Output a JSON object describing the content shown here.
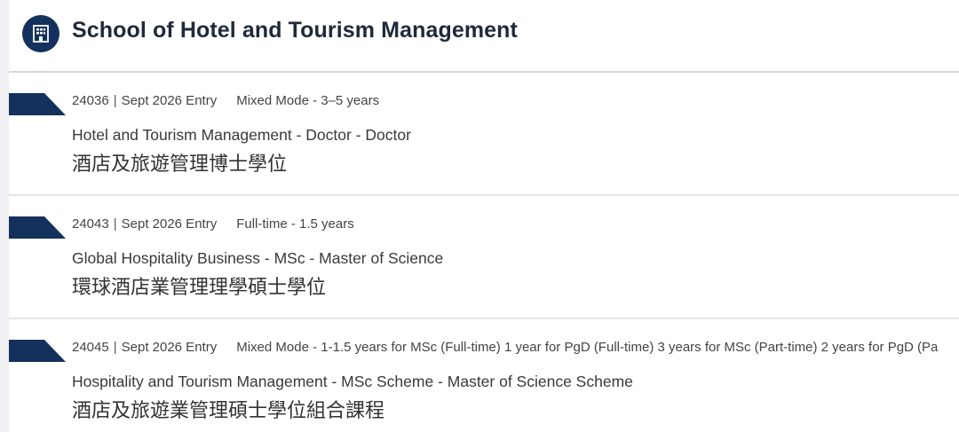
{
  "school": {
    "title": "School of Hotel and Tourism Management",
    "icon": "building-icon",
    "icon_color": "#13315c"
  },
  "programs": [
    {
      "code": "24036",
      "entry": "Sept 2026 Entry",
      "mode": "Mixed Mode - 3–5 years",
      "name_en": "Hotel and Tourism Management - Doctor - Doctor",
      "name_zh": "酒店及旅遊管理博士學位"
    },
    {
      "code": "24043",
      "entry": "Sept 2026 Entry",
      "mode": "Full-time - 1.5 years",
      "name_en": "Global Hospitality Business - MSc - Master of Science",
      "name_zh": "環球酒店業管理理學碩士學位"
    },
    {
      "code": "24045",
      "entry": "Sept 2026 Entry",
      "mode": "Mixed Mode - 1-1.5 years for MSc (Full-time) 1 year for PgD (Full-time) 3 years for MSc (Part-time) 2 years for PgD (Pa",
      "name_en": "Hospitality and Tourism Management - MSc Scheme - Master of Science Scheme",
      "name_zh": "酒店及旅遊業管理碩士學位組合課程"
    }
  ],
  "separator": "|",
  "flag_color": "#13315c"
}
